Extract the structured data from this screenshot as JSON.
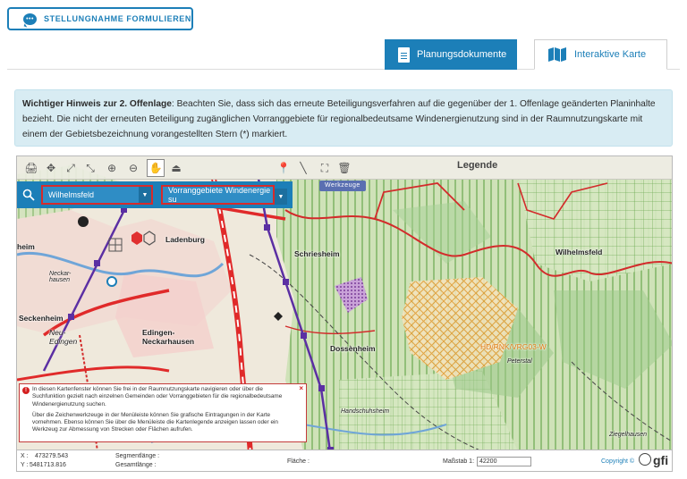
{
  "header": {
    "statement_button": "STELLUNGNAHME FORMULIEREN"
  },
  "tabs": [
    {
      "label": "Planungsdokumente",
      "active": false
    },
    {
      "label": "Interaktive Karte",
      "active": true
    }
  ],
  "hint": {
    "bold": "Wichtiger Hinweis zur 2. Offenlage",
    "text": ": Beachten Sie, dass sich das erneute Beteiligungsverfahren auf die gegenüber der 1. Offenlage geänderten Planinhalte bezieht. Die nicht der erneuten Beteiligung zugänglichen Vorranggebiete für regionalbedeutsame Windenergienutzung sind in der Raumnutzungskarte mit einem der Gebietsbezeichnung vorangestellten Stern (*) markiert."
  },
  "map": {
    "legend_label": "Legende",
    "tools_label": "Werkzeuge",
    "gemeinde_select": "Wilhelmsfeld",
    "vorrang_select": "Vorranggebiete Windenergie su",
    "places": {
      "ladenburg": "Ladenburg",
      "schriesheim": "Schriesheim",
      "wilhelmsfeld": "Wilhelmsfeld",
      "heim": "heim",
      "seckenheim": "Seckenheim",
      "neu_edingen": "Neu-\nEdingen",
      "edingen": "Edingen-\nNeckarhausen",
      "dossenheim": "Dossenheim",
      "neckarhausen_label": "Neckar-\nhausen",
      "vorranggebiet": "HD/RNK/VRG03-W",
      "peterstal": "Peterstal",
      "handschuhsheim": "Handschuhsheim",
      "ziegelhausen": "Ziegelhausen"
    },
    "info": {
      "p1": "In diesen Kartenfenster können Sie frei in der Raumnutzungskarte navigieren oder über die Suchfunktion gezielt nach einzelnen Gemeinden oder Vorranggebieten für die regionalbedeutsame Windenergienutzung suchen.",
      "p2": "Über die Zeichenwerkzeuge in der Menüleiste können Sie grafische Eintragungen in der Karte vornehmen. Ebenso können Sie über die Menüleiste die Kartenlegende anzeigen lassen oder ein Werkzeug zur Abmessung von Strecken oder Flächen aufrufen."
    },
    "status": {
      "x_label": "X :",
      "x_value": "473279.543",
      "y_label": "Y :",
      "y_value": "5481713.816",
      "segment_label": "Segmentlänge :",
      "total_label": "Gesamtlänge :",
      "area_label": "Fläche :",
      "scale_label": "Maßstab 1:",
      "scale_value": "42200",
      "copyright": "Copyright ©",
      "logo_text": "gfi"
    }
  },
  "colors": {
    "accent": "#1c7fb8",
    "highlight": "#d62b2b",
    "hint_bg": "#d8ecf3"
  }
}
